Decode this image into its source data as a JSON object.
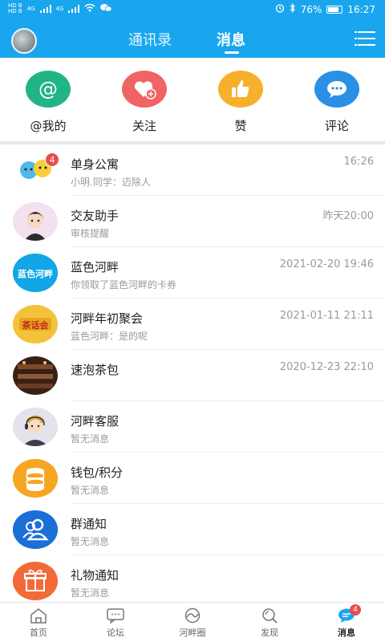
{
  "status_bar": {
    "left": [
      "HD B",
      "HD B",
      "4G",
      "4G"
    ],
    "battery": "76%",
    "time": "16:27"
  },
  "header": {
    "tabs": [
      {
        "label": "通讯录"
      },
      {
        "label": "消息"
      }
    ],
    "active_tab": "消息"
  },
  "quick_actions": [
    {
      "label": "@我的",
      "color": "#21b486",
      "icon": "at-icon"
    },
    {
      "label": "关注",
      "color": "#f06464",
      "icon": "heart-plus-icon"
    },
    {
      "label": "赞",
      "color": "#f7b02b",
      "icon": "thumbs-up-icon"
    },
    {
      "label": "评论",
      "color": "#2a8fe6",
      "icon": "comment-icon"
    }
  ],
  "messages": [
    {
      "title": "单身公寓",
      "subtitle": "小明.同学：迈除人",
      "time": "16:26",
      "badge": "4"
    },
    {
      "title": "交友助手",
      "subtitle": "审核提醒",
      "time": "昨天20:00"
    },
    {
      "title": "蓝色河畔",
      "subtitle": "你领取了蓝色河畔的卡券",
      "time": "2021-02-20 19:46",
      "logo_text": "蓝色河畔"
    },
    {
      "title": "河畔年初聚会",
      "subtitle": "蓝色河畔：是的呢",
      "time": "2021-01-11 21:11",
      "logo_text": "茶话会"
    },
    {
      "title": "速泡茶包",
      "subtitle": "",
      "time": "2020-12-23 22:10"
    },
    {
      "title": "河畔客服",
      "subtitle": "暂无消息",
      "time": ""
    },
    {
      "title": "钱包/积分",
      "subtitle": "暂无消息",
      "time": ""
    },
    {
      "title": "群通知",
      "subtitle": "暂无消息",
      "time": ""
    },
    {
      "title": "礼物通知",
      "subtitle": "暂无消息",
      "time": ""
    }
  ],
  "bottom_nav": [
    {
      "label": "首页",
      "icon": "home-icon"
    },
    {
      "label": "论坛",
      "icon": "forum-icon"
    },
    {
      "label": "河畔圈",
      "icon": "circle-icon"
    },
    {
      "label": "发现",
      "icon": "discover-icon"
    },
    {
      "label": "消息",
      "icon": "message-icon",
      "badge": "4",
      "active": true
    }
  ],
  "colors": {
    "primary": "#1aa6ef",
    "badge": "#e84c4c"
  }
}
